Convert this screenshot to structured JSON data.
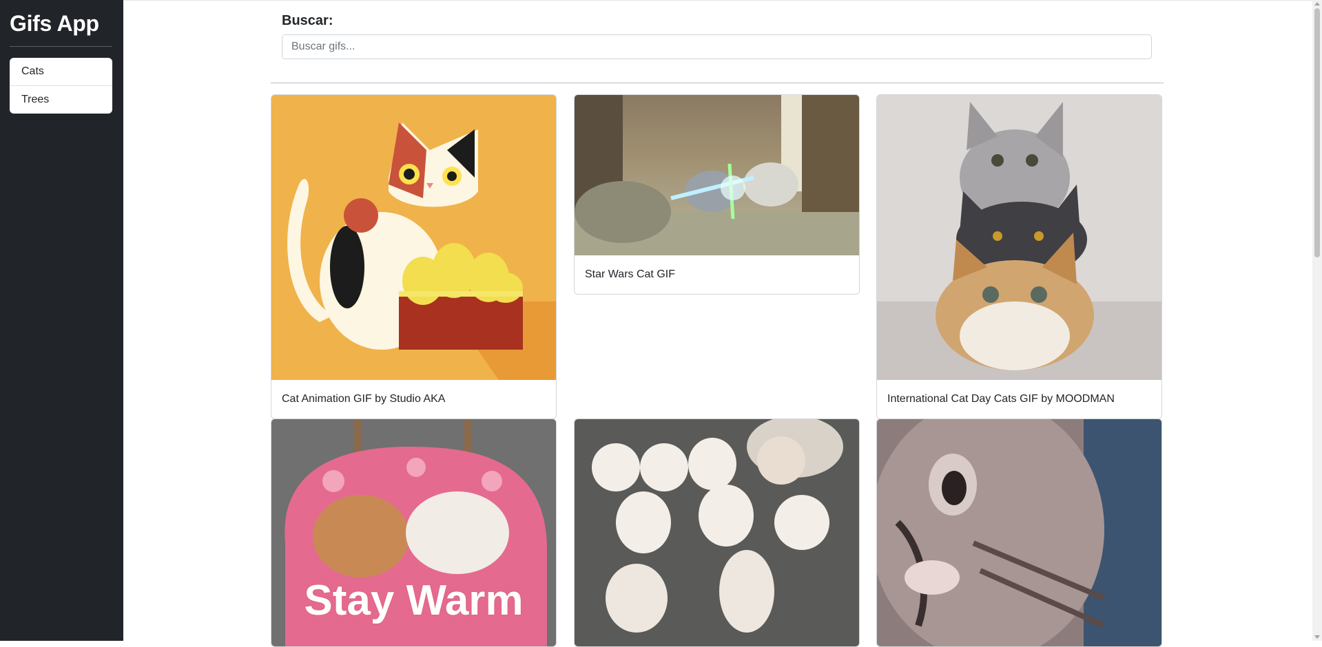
{
  "app": {
    "title": "Gifs App"
  },
  "sidebar": {
    "items": [
      {
        "label": "Cats"
      },
      {
        "label": "Trees"
      }
    ]
  },
  "search": {
    "label": "Buscar:",
    "placeholder": "Buscar gifs...",
    "value": ""
  },
  "gifs": [
    {
      "title": "Cat Animation GIF by Studio AKA"
    },
    {
      "title": "Star Wars Cat GIF"
    },
    {
      "title": "International Cat Day Cats GIF by MOODMAN"
    },
    {
      "title": "",
      "overlay_text": "Stay Warm"
    },
    {
      "title": ""
    },
    {
      "title": ""
    }
  ],
  "colors": {
    "sidebar_bg": "#212529",
    "accent_orange": "#f0b24a"
  }
}
